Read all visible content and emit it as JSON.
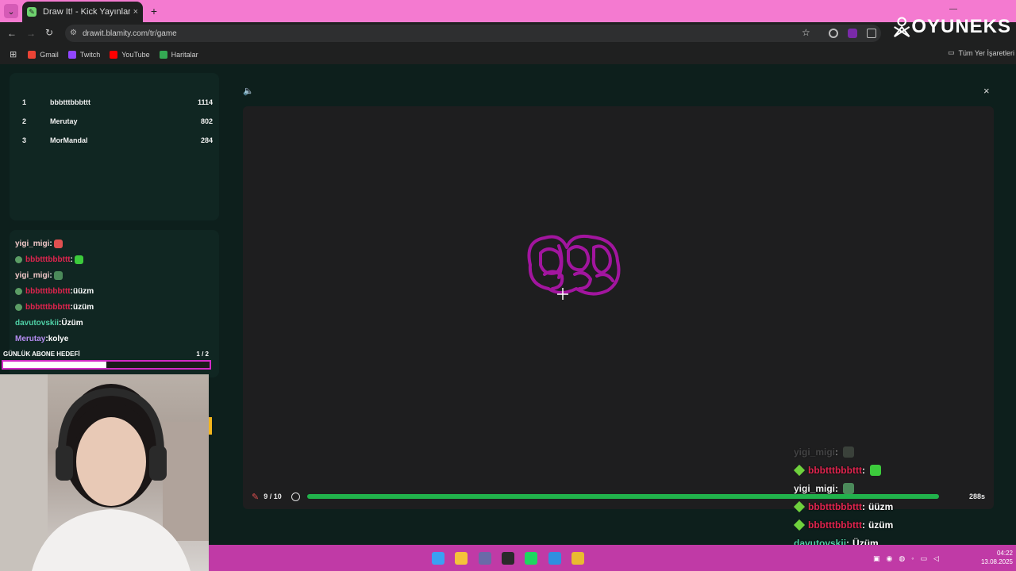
{
  "browser": {
    "tab_title": "Draw It! - Kick Yayınları İçin Çizim",
    "tab_close": "×",
    "new_tab": "+",
    "url": "drawit.blamity.com/tr/game",
    "bookmarks": [
      {
        "label": "Gmail",
        "color": "#ea4335"
      },
      {
        "label": "Twitch",
        "color": "#9146ff"
      },
      {
        "label": "YouTube",
        "color": "#ff0000"
      },
      {
        "label": "Haritalar",
        "color": "#34a853"
      }
    ],
    "all_bookmarks": "Tüm Yer İşaretleri"
  },
  "watermark": "OYUNEKS",
  "leaderboard": [
    {
      "rank": "1",
      "name": "bbbtttbbbttt",
      "score": "1114"
    },
    {
      "rank": "2",
      "name": "Merutay",
      "score": "802"
    },
    {
      "rank": "3",
      "name": "MorMandal",
      "score": "284"
    }
  ],
  "chat": [
    {
      "user": "yigi_migi",
      "sep": ":",
      "msg": "",
      "color": "#f0c8c8",
      "badge": false,
      "emote": "#e05050"
    },
    {
      "user": "bbbtttbbbttt",
      "sep": ":",
      "msg": "",
      "color": "#e0244e",
      "badge": true,
      "emote": "#3ccb3c"
    },
    {
      "user": "yigi_migi",
      "sep": ":",
      "msg": "",
      "color": "#f0c8c8",
      "badge": false,
      "emote": "#4b8a5a"
    },
    {
      "user": "bbbtttbbbttt",
      "sep": ":",
      "msg": "üüzm",
      "color": "#e0244e",
      "badge": true,
      "emote": null
    },
    {
      "user": "bbbtttbbbttt",
      "sep": ":",
      "msg": "üzüm",
      "color": "#e0244e",
      "badge": true,
      "emote": null
    },
    {
      "user": "davutovskii",
      "sep": ":",
      "msg": "Üzüm",
      "color": "#4fd0a6",
      "badge": false,
      "emote": null
    },
    {
      "user": "Merutay",
      "sep": ":",
      "msg": "kolye",
      "color": "#b58cf2",
      "badge": false,
      "emote": null
    }
  ],
  "sub_goal": {
    "label": "GÜNLÜK ABONE HEDEFİ",
    "count": "1 / 2",
    "progress": 0.5
  },
  "game": {
    "round": "9 / 10",
    "time": "288s",
    "time_progress": 1.0,
    "close": "×",
    "sound": "🔈",
    "stroke_color": "#a2159f"
  },
  "overlay_chat": [
    {
      "user": "yigi_migi",
      "sep": " :",
      "msg": "",
      "color": "#6f6f6f",
      "badge": false,
      "emote": "#5c6c5c",
      "faded": true
    },
    {
      "user": "bbbtttbbbttt",
      "sep": " :",
      "msg": "",
      "color": "#e0244e",
      "badge": true,
      "emote": "#3ccb3c"
    },
    {
      "user": "yigi_migi",
      "sep": " :",
      "msg": "",
      "color": "#f0f0f0",
      "badge": false,
      "emote": "#4b8a5a"
    },
    {
      "user": "bbbtttbbbttt",
      "sep": " :",
      "msg": "üüzm",
      "color": "#e0244e",
      "badge": true,
      "emote": null
    },
    {
      "user": "bbbtttbbbttt",
      "sep": " :",
      "msg": "üzüm",
      "color": "#e0244e",
      "badge": true,
      "emote": null
    },
    {
      "user": "davutovskii",
      "sep": " :",
      "msg": "Üzüm",
      "color": "#4fd0a6",
      "badge": false,
      "emote": null
    },
    {
      "user": "Merutay",
      "sep": " :",
      "msg": "kolye",
      "color": "#b58cf2",
      "badge": false,
      "emote": null
    }
  ],
  "clock": {
    "time": "04:22",
    "date": "13.08.2025"
  },
  "taskbar_icons": [
    {
      "name": "windows-start-icon",
      "color": "#3aa0f3"
    },
    {
      "name": "file-explorer-icon",
      "color": "#f4c33a"
    },
    {
      "name": "settings-app-icon",
      "color": "#6a6aa8"
    },
    {
      "name": "obs-icon",
      "color": "#2a2a2a"
    },
    {
      "name": "spotify-icon",
      "color": "#1ed760"
    },
    {
      "name": "app-icon",
      "color": "#2f8fe0"
    },
    {
      "name": "chrome-icon",
      "color": "#e9bb30"
    }
  ]
}
